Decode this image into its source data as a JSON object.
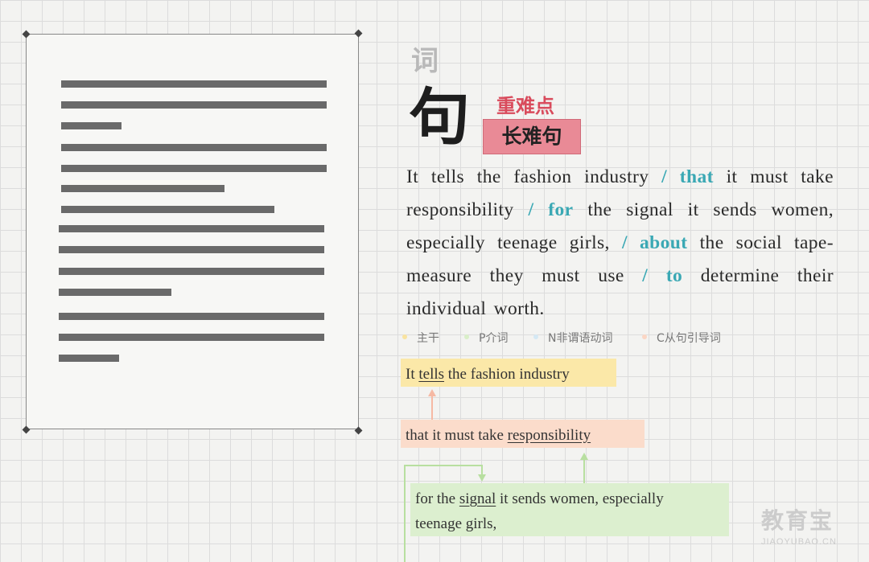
{
  "heading": {
    "ci": "词",
    "ju": "句",
    "zhong_nan_dian": "重难点",
    "chang_nan_ju": "长难句"
  },
  "sentence": {
    "s1": "It tells the fashion industry ",
    "slash1": "/ ",
    "kw1": "that",
    "s2": " it must take responsibility ",
    "slash2": "/ ",
    "kw2": "for",
    "s3": " the signal it sends women, especially teenage girls, ",
    "slash3": "/ ",
    "kw3": "about",
    "s4": " the social tape-measure they must use ",
    "slash4": "/ ",
    "kw4": "to",
    "s5": " determine their individual worth."
  },
  "legend": [
    {
      "label": "主干",
      "color": "#f9e3a0"
    },
    {
      "label": "P介词",
      "color": "#d9efc8"
    },
    {
      "label": "N非谓语动词",
      "color": "#d4e8f4"
    },
    {
      "label": "C从句引导词",
      "color": "#fbd6c4"
    }
  ],
  "analysis": {
    "box1": {
      "pre": "It ",
      "u": "tells",
      "post": " the fashion industry"
    },
    "box2": {
      "pre": "that it must take ",
      "u": "responsibility"
    },
    "box3": {
      "pre": "for the ",
      "u": "signal",
      "post": " it sends women, especially",
      "line2": "teenage girls,"
    }
  },
  "colors": {
    "main": "#fbe8a8",
    "clause": "#fbdccb",
    "prep": "#dcefcf",
    "accent": "#3aa8b4",
    "red": "#d94b5c"
  },
  "watermark": {
    "cn": "教育宝",
    "en": "JIAOYUBAO.CN"
  }
}
